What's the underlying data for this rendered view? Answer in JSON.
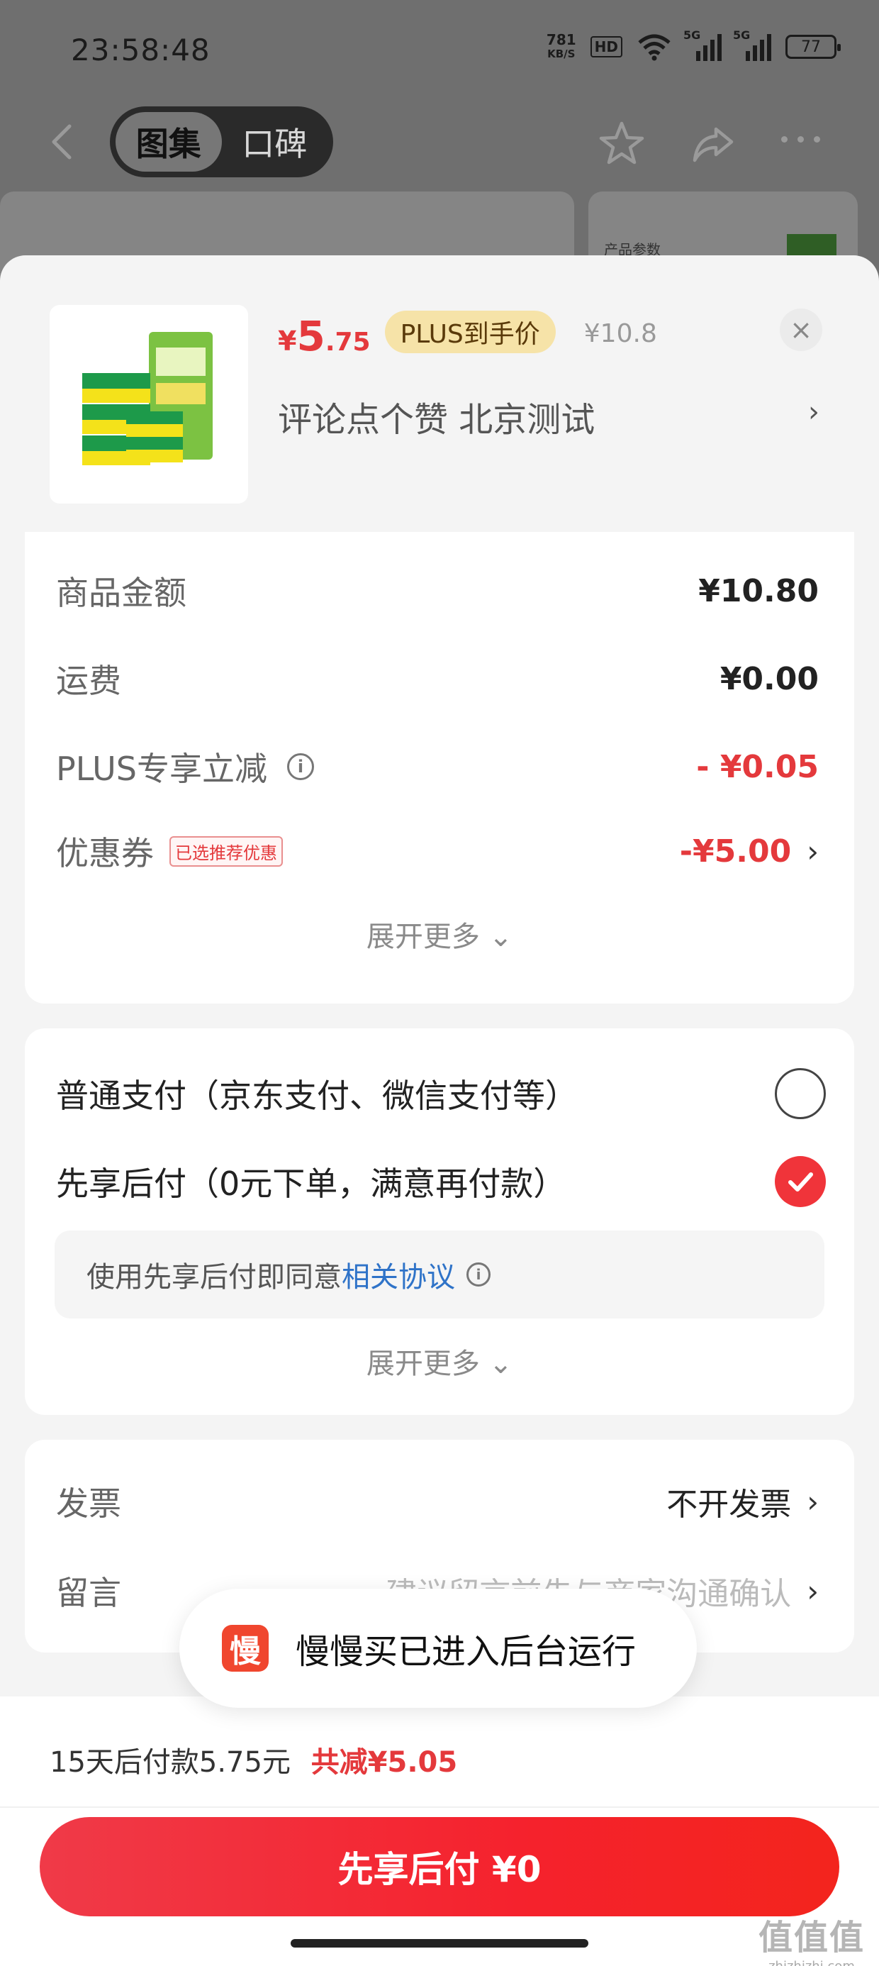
{
  "status_bar": {
    "time": "23:58:48",
    "net_speed_value": "781",
    "net_speed_unit": "KB/S",
    "hd": "HD",
    "sim1": "5G",
    "sim2": "5G",
    "battery": "77"
  },
  "top_nav": {
    "tabs": [
      {
        "label": "图集",
        "active": true
      },
      {
        "label": "口碑",
        "active": false
      }
    ]
  },
  "background_card": {
    "param_label": "产品参数"
  },
  "product": {
    "price_currency": "¥",
    "price_int": "5",
    "price_dec": ".75",
    "plus_tag": "PLUS到手价",
    "original_price": "¥10.8",
    "subtitle": "评论点个赞  北京测试",
    "close_label": "×"
  },
  "summary": {
    "rows": [
      {
        "label": "商品金额",
        "value": "¥10.80"
      },
      {
        "label": "运费",
        "value": "¥0.00"
      },
      {
        "label": "PLUS专享立减",
        "value": "- ¥0.05"
      },
      {
        "label": "优惠券",
        "tag": "已选推荐优惠",
        "value": "-¥5.00"
      }
    ],
    "expand_label": "展开更多"
  },
  "payment": {
    "options": [
      {
        "label": "普通支付（京东支付、微信支付等）",
        "selected": false
      },
      {
        "label": "先享后付（0元下单，满意再付款）",
        "selected": true
      }
    ],
    "agree_text": "使用先享后付即同意",
    "agree_link": "相关协议",
    "expand_label": "展开更多"
  },
  "extras": {
    "invoice_label": "发票",
    "invoice_value": "不开发票",
    "message_label": "留言",
    "message_placeholder": "建议留言前先与商家沟通确认"
  },
  "toast": {
    "icon_char": "慢",
    "text": "慢慢买已进入后台运行"
  },
  "footer": {
    "summary_text": "15天后付款5.75元",
    "discount_text": "共减¥5.05",
    "cta_label": "先享后付 ¥0"
  },
  "watermark": {
    "big": "值值值",
    "small": "zhizhizhi.com"
  },
  "colors": {
    "accent_red": "#e4393c",
    "link_blue": "#2f73c8",
    "plus_gold": "#f6e3a8"
  }
}
